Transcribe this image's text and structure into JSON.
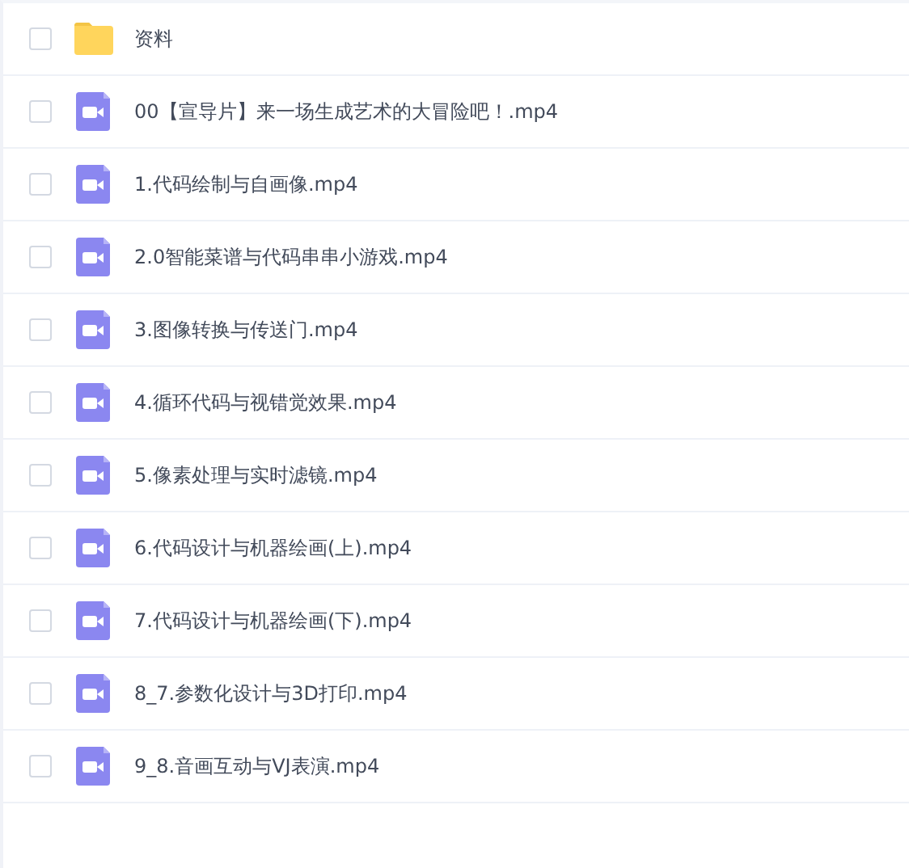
{
  "files": [
    {
      "kind": "folder",
      "name": "资料",
      "checked": false
    },
    {
      "kind": "video",
      "name": "00【宣导片】来一场生成艺术的大冒险吧！.mp4",
      "checked": false
    },
    {
      "kind": "video",
      "name": "1.代码绘制与自画像.mp4",
      "checked": false
    },
    {
      "kind": "video",
      "name": "2.0智能菜谱与代码串串小游戏.mp4",
      "checked": false
    },
    {
      "kind": "video",
      "name": "3.图像转换与传送门.mp4",
      "checked": false
    },
    {
      "kind": "video",
      "name": "4.循环代码与视错觉效果.mp4",
      "checked": false
    },
    {
      "kind": "video",
      "name": "5.像素处理与实时滤镜.mp4",
      "checked": false
    },
    {
      "kind": "video",
      "name": "6.代码设计与机器绘画(上).mp4",
      "checked": false
    },
    {
      "kind": "video",
      "name": "7.代码设计与机器绘画(下).mp4",
      "checked": false
    },
    {
      "kind": "video",
      "name": "8_7.参数化设计与3D打印.mp4",
      "checked": false
    },
    {
      "kind": "video",
      "name": "9_8.音画互动与VJ表演.mp4",
      "checked": false
    }
  ]
}
